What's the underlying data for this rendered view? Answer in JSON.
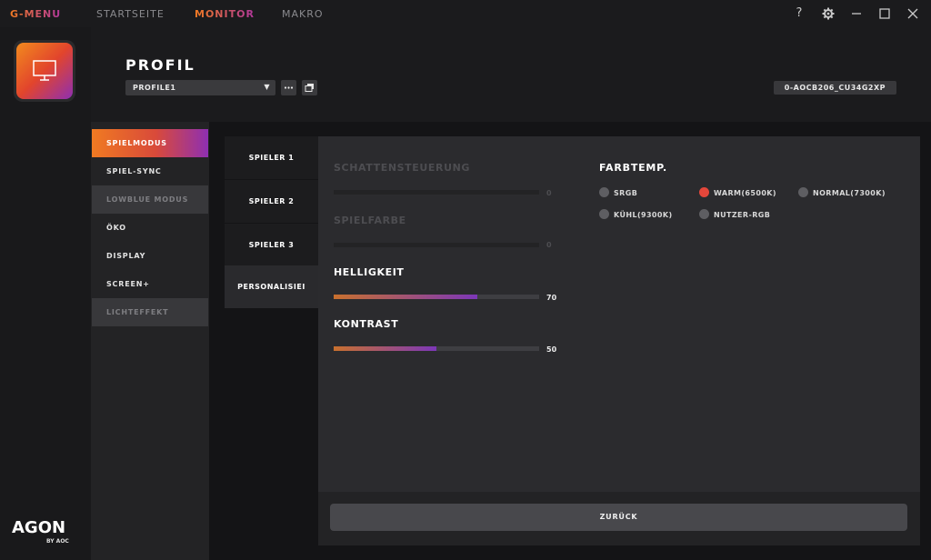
{
  "app": {
    "brand": "G-MENU",
    "nav": [
      "STARTSEITE",
      "MONITOR",
      "MAKRO"
    ],
    "active_nav": "MONITOR"
  },
  "window_controls": {
    "help": "?",
    "settings_icon": "gear-icon",
    "minimize_icon": "minimize-icon",
    "maximize_icon": "maximize-icon",
    "close_icon": "close-icon"
  },
  "rail": {
    "logo": "AGON",
    "logo_sub": "BY AOC",
    "icon": "monitor-icon"
  },
  "header": {
    "title": "PROFIL",
    "profile_value": "PROFILE1",
    "device": "0-AOCB206_CU34G2XP",
    "more_icon": "more-icon",
    "copy_icon": "copy-icon"
  },
  "submenu": [
    {
      "label": "SPIELMODUS",
      "state": "active"
    },
    {
      "label": "SPIEL-SYNC",
      "state": "normal"
    },
    {
      "label": "LOWBLUE MODUS",
      "state": "disabled"
    },
    {
      "label": "ÖKO",
      "state": "normal"
    },
    {
      "label": "DISPLAY",
      "state": "normal"
    },
    {
      "label": "SCREEN+",
      "state": "normal"
    },
    {
      "label": "LICHTEFFEKT",
      "state": "disabled"
    }
  ],
  "tabs": [
    {
      "label": "SPIELER 1",
      "active": false
    },
    {
      "label": "SPIELER 2",
      "active": false
    },
    {
      "label": "SPIELER 3",
      "active": false
    },
    {
      "label": "PERSONALISIEI",
      "active": true
    }
  ],
  "sliders": [
    {
      "label": "SCHATTENSTEUERUNG",
      "value": "0",
      "percent": 0,
      "disabled": true
    },
    {
      "label": "SPIELFARBE",
      "value": "0",
      "percent": 0,
      "disabled": true
    },
    {
      "label": "HELLIGKEIT",
      "value": "70",
      "percent": 70,
      "disabled": false
    },
    {
      "label": "KONTRAST",
      "value": "50",
      "percent": 50,
      "disabled": false
    }
  ],
  "farbtemp": {
    "title": "FARBTEMP.",
    "options": [
      "SRGB",
      "WARM(6500K)",
      "NORMAL(7300K)",
      "KÜHL(9300K)",
      "NUTZER-RGB"
    ],
    "selected": "WARM(6500K)"
  },
  "footer": {
    "back_label": "ZURÜCK"
  },
  "colors": {
    "accent_orange": "#f07a22",
    "accent_purple": "#8e2fb2",
    "radio_selected": "#e4473b"
  }
}
